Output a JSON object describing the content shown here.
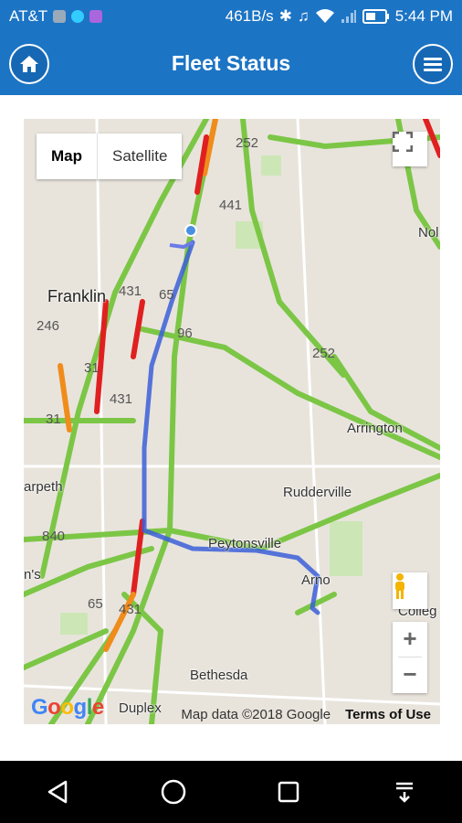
{
  "status_bar": {
    "carrier": "AT&T",
    "net_speed": "461B/s",
    "time": "5:44 PM"
  },
  "app_bar": {
    "title": "Fleet Status",
    "home_icon": "home-icon",
    "menu_icon": "hamburger-menu-icon"
  },
  "map": {
    "type_control": {
      "map_label": "Map",
      "satellite_label": "Satellite",
      "selected": "Map"
    },
    "places": {
      "franklin": "Franklin",
      "arrington": "Arrington",
      "rudderville": "Rudderville",
      "peytonsville": "Peytonsville",
      "arno": "Arno",
      "bethesda": "Bethesda",
      "duplex": "Duplex",
      "nol": "Nol",
      "college": "Colleg",
      "arpeth": "arpeth",
      "ns": "n's"
    },
    "route_shields": [
      "252",
      "441",
      "431",
      "246",
      "96",
      "31",
      "431",
      "252",
      "31",
      "840",
      "65",
      "431",
      "65"
    ],
    "attribution": {
      "data": "Map data ©2018 Google",
      "terms": "Terms of Use",
      "logo": "Google"
    },
    "zoom": {
      "in": "+",
      "out": "−"
    },
    "colors": {
      "route": "#3b5fd8",
      "highway_green": "#7cc646",
      "traffic_red": "#e02020",
      "traffic_orange": "#f08c1c"
    }
  },
  "system_nav": {
    "back_icon": "back-triangle-icon",
    "home_icon": "home-circle-icon",
    "recents_icon": "recents-square-icon",
    "notifications_icon": "notification-pull-icon"
  }
}
